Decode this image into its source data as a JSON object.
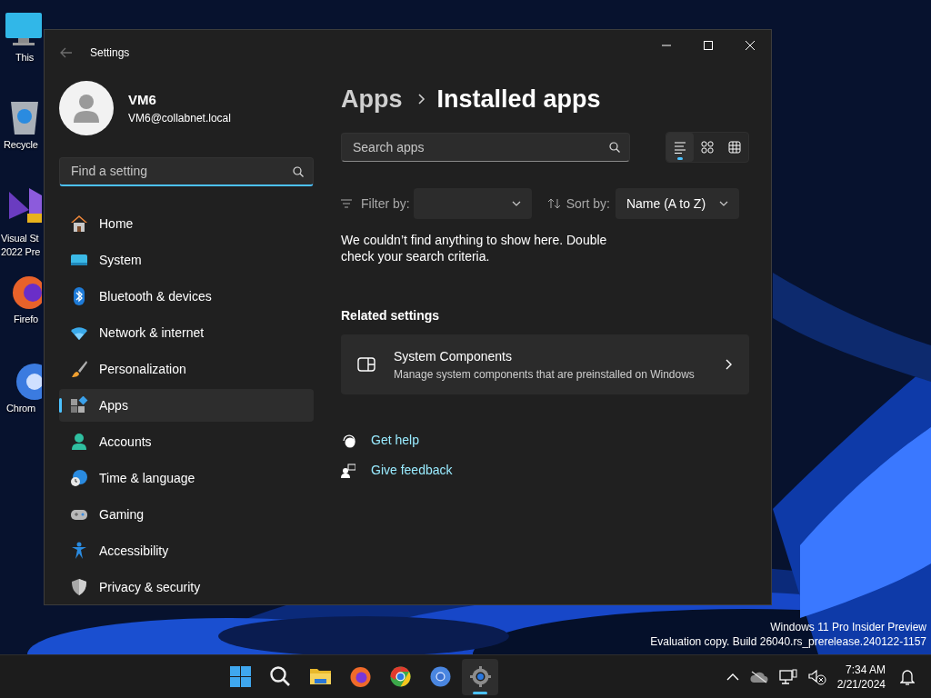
{
  "desktop_icons": [
    {
      "lines": [
        "This"
      ]
    },
    {
      "lines": [
        "Recycle"
      ]
    },
    {
      "lines": [
        "Visual St",
        "2022 Pre"
      ]
    },
    {
      "lines": [
        "Firefo"
      ]
    },
    {
      "lines": [
        "Chrom"
      ]
    }
  ],
  "window": {
    "title": "Settings"
  },
  "account": {
    "name": "VM6",
    "email": "VM6@collabnet.local"
  },
  "search": {
    "placeholder": "Find a setting"
  },
  "nav": [
    {
      "label": "Home",
      "selected": false
    },
    {
      "label": "System",
      "selected": false
    },
    {
      "label": "Bluetooth & devices",
      "selected": false
    },
    {
      "label": "Network & internet",
      "selected": false
    },
    {
      "label": "Personalization",
      "selected": false
    },
    {
      "label": "Apps",
      "selected": true
    },
    {
      "label": "Accounts",
      "selected": false
    },
    {
      "label": "Time & language",
      "selected": false
    },
    {
      "label": "Gaming",
      "selected": false
    },
    {
      "label": "Accessibility",
      "selected": false
    },
    {
      "label": "Privacy & security",
      "selected": false
    }
  ],
  "breadcrumb": {
    "parent": "Apps",
    "current": "Installed apps"
  },
  "app_search": {
    "placeholder": "Search apps"
  },
  "view_modes": [
    {
      "selected": true
    },
    {
      "selected": false
    },
    {
      "selected": false
    }
  ],
  "filter": {
    "label": "Filter by:"
  },
  "sort": {
    "label": "Sort by:",
    "value": "Name (A to Z)"
  },
  "empty_message": "We couldn’t find anything to show here. Double check your search criteria.",
  "related": {
    "heading": "Related settings",
    "items": [
      {
        "title": "System Components",
        "description": "Manage system components that are preinstalled on Windows"
      }
    ]
  },
  "links": [
    {
      "label": "Get help"
    },
    {
      "label": "Give feedback"
    }
  ],
  "edition_notice": [
    "Windows 11 Pro Insider Preview",
    "Evaluation copy. Build 26040.rs_prerelease.240122-1157"
  ],
  "taskbar": {
    "apps": [
      {
        "selected": false
      },
      {
        "selected": false
      },
      {
        "selected": false
      },
      {
        "selected": false
      },
      {
        "selected": false
      },
      {
        "selected": false
      },
      {
        "selected": true
      }
    ],
    "clock": {
      "time": "7:34 AM",
      "date": "2/21/2024"
    }
  }
}
